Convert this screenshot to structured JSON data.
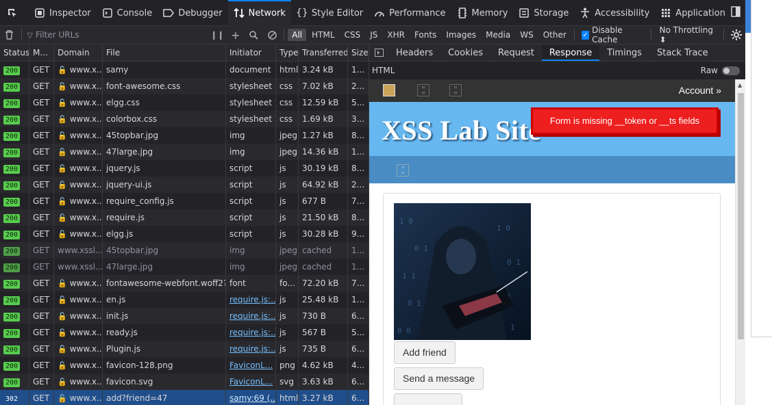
{
  "toolbox": {
    "tabs": [
      {
        "label": "Inspector",
        "icon": "inspector-icon"
      },
      {
        "label": "Console",
        "icon": "console-icon"
      },
      {
        "label": "Debugger",
        "icon": "debugger-icon"
      },
      {
        "label": "Network",
        "icon": "network-icon",
        "active": true
      },
      {
        "label": "Style Editor",
        "icon": "style-editor-icon"
      },
      {
        "label": "Performance",
        "icon": "performance-icon"
      },
      {
        "label": "Memory",
        "icon": "memory-icon"
      },
      {
        "label": "Storage",
        "icon": "storage-icon"
      },
      {
        "label": "Accessibility",
        "icon": "accessibility-icon"
      },
      {
        "label": "Application",
        "icon": "application-icon"
      }
    ]
  },
  "filterbar": {
    "filter_placeholder": "Filter URLs",
    "type_filters": [
      "All",
      "HTML",
      "CSS",
      "JS",
      "XHR",
      "Fonts",
      "Images",
      "Media",
      "WS",
      "Other"
    ],
    "active_filter": "All",
    "disable_cache_label": "Disable Cache",
    "disable_cache_checked": true,
    "throttling_label": "No Throttling ⬍"
  },
  "table": {
    "columns": [
      "Status",
      "M...",
      "Domain",
      "File",
      "Initiator",
      "Type",
      "Transferred",
      "Size"
    ],
    "rows": [
      {
        "status": "200",
        "method": "GET",
        "domain": "www.x...",
        "file": "samy",
        "initiator": "document",
        "type": "html",
        "transferred": "3.24 kB",
        "size": "1...",
        "link": false,
        "cached": false
      },
      {
        "status": "200",
        "method": "GET",
        "domain": "www.x...",
        "file": "font-awesome.css",
        "initiator": "stylesheet",
        "type": "css",
        "transferred": "7.02 kB",
        "size": "2...",
        "link": false,
        "cached": false
      },
      {
        "status": "200",
        "method": "GET",
        "domain": "www.x...",
        "file": "elgg.css",
        "initiator": "stylesheet",
        "type": "css",
        "transferred": "12.59 kB",
        "size": "5...",
        "link": false,
        "cached": false
      },
      {
        "status": "200",
        "method": "GET",
        "domain": "www.x...",
        "file": "colorbox.css",
        "initiator": "stylesheet",
        "type": "css",
        "transferred": "1.69 kB",
        "size": "3...",
        "link": false,
        "cached": false
      },
      {
        "status": "200",
        "method": "GET",
        "domain": "www.x...",
        "file": "45topbar.jpg",
        "initiator": "img",
        "type": "jpeg",
        "transferred": "1.27 kB",
        "size": "8...",
        "link": false,
        "cached": false
      },
      {
        "status": "200",
        "method": "GET",
        "domain": "www.x...",
        "file": "47large.jpg",
        "initiator": "img",
        "type": "jpeg",
        "transferred": "14.36 kB",
        "size": "1...",
        "link": false,
        "cached": false
      },
      {
        "status": "200",
        "method": "GET",
        "domain": "www.x...",
        "file": "jquery.js",
        "initiator": "script",
        "type": "js",
        "transferred": "30.19 kB",
        "size": "8...",
        "link": false,
        "cached": false
      },
      {
        "status": "200",
        "method": "GET",
        "domain": "www.x...",
        "file": "jquery-ui.js",
        "initiator": "script",
        "type": "js",
        "transferred": "64.92 kB",
        "size": "2...",
        "link": false,
        "cached": false
      },
      {
        "status": "200",
        "method": "GET",
        "domain": "www.x...",
        "file": "require_config.js",
        "initiator": "script",
        "type": "js",
        "transferred": "677 B",
        "size": "7...",
        "link": false,
        "cached": false
      },
      {
        "status": "200",
        "method": "GET",
        "domain": "www.x...",
        "file": "require.js",
        "initiator": "script",
        "type": "js",
        "transferred": "21.50 kB",
        "size": "8...",
        "link": false,
        "cached": false
      },
      {
        "status": "200",
        "method": "GET",
        "domain": "www.x...",
        "file": "elgg.js",
        "initiator": "script",
        "type": "js",
        "transferred": "30.28 kB",
        "size": "9...",
        "link": false,
        "cached": false
      },
      {
        "status": "200",
        "method": "GET",
        "domain": "www.xssl...",
        "file": "45topbar.jpg",
        "initiator": "img",
        "type": "jpeg",
        "transferred": "cached",
        "size": "1...",
        "link": false,
        "cached": true
      },
      {
        "status": "200",
        "method": "GET",
        "domain": "www.xssl...",
        "file": "47large.jpg",
        "initiator": "img",
        "type": "jpeg",
        "transferred": "cached",
        "size": "1...",
        "link": false,
        "cached": true
      },
      {
        "status": "200",
        "method": "GET",
        "domain": "www.x...",
        "file": "fontawesome-webfont.woff2?v=4",
        "initiator": "font",
        "type": "fo...",
        "transferred": "72.20 kB",
        "size": "7...",
        "link": false,
        "cached": false
      },
      {
        "status": "200",
        "method": "GET",
        "domain": "www.x...",
        "file": "en.js",
        "initiator": "require.js:...",
        "type": "js",
        "transferred": "25.48 kB",
        "size": "1...",
        "link": true,
        "cached": false
      },
      {
        "status": "200",
        "method": "GET",
        "domain": "www.x...",
        "file": "init.js",
        "initiator": "require.js:...",
        "type": "js",
        "transferred": "730 B",
        "size": "6...",
        "link": true,
        "cached": false
      },
      {
        "status": "200",
        "method": "GET",
        "domain": "www.x...",
        "file": "ready.js",
        "initiator": "require.js:...",
        "type": "js",
        "transferred": "567 B",
        "size": "5...",
        "link": true,
        "cached": false
      },
      {
        "status": "200",
        "method": "GET",
        "domain": "www.x...",
        "file": "Plugin.js",
        "initiator": "require.js:...",
        "type": "js",
        "transferred": "735 B",
        "size": "6...",
        "link": true,
        "cached": false
      },
      {
        "status": "200",
        "method": "GET",
        "domain": "www.x...",
        "file": "favicon-128.png",
        "initiator": "FaviconL...",
        "type": "png",
        "transferred": "4.62 kB",
        "size": "4...",
        "link": true,
        "cached": false
      },
      {
        "status": "200",
        "method": "GET",
        "domain": "www.x...",
        "file": "favicon.svg",
        "initiator": "FaviconL...",
        "type": "svg",
        "transferred": "3.63 kB",
        "size": "6...",
        "link": true,
        "cached": false
      },
      {
        "status": "302",
        "method": "GET",
        "domain": "www.x...",
        "file": "add?friend=47",
        "initiator": "samy:69 (...",
        "type": "html",
        "transferred": "3.27 kB",
        "size": "6...",
        "link": true,
        "cached": false,
        "selected": true
      }
    ]
  },
  "panel": {
    "tabs": [
      "Headers",
      "Cookies",
      "Request",
      "Response",
      "Timings",
      "Stack Trace"
    ],
    "active_tab": "Response",
    "section_label": "HTML",
    "raw_label": "Raw",
    "raw_on": false
  },
  "preview": {
    "account_label": "Account »",
    "site_title": "XSS Lab Site",
    "alert_text": "Form is missing __token or __ts fields",
    "add_friend_label": "Add friend",
    "send_message_label": "Send a message",
    "colors": {
      "topbar": "#333333",
      "header": "#67b8f0",
      "navbar": "#4a8cc4",
      "alert": "#ee1f1f"
    }
  }
}
